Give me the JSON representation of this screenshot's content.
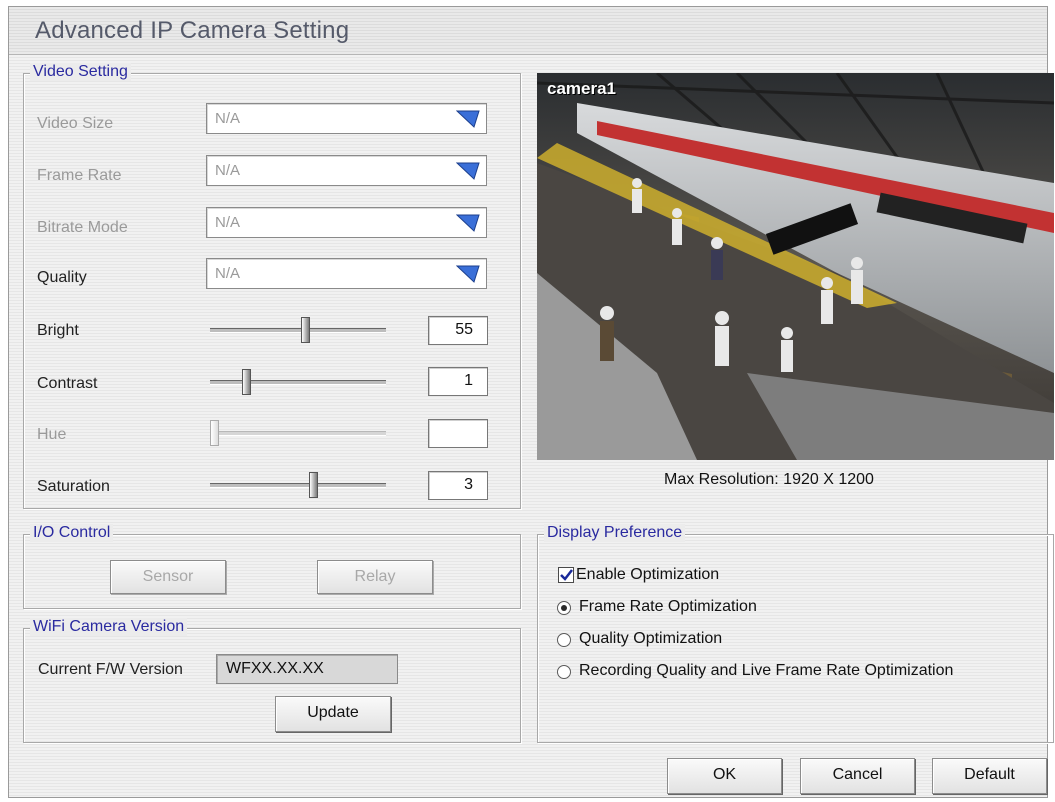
{
  "window": {
    "title": "Advanced IP Camera Setting"
  },
  "video_setting": {
    "legend": "Video Setting",
    "video_size": {
      "label": "Video Size",
      "value": "N/A"
    },
    "frame_rate": {
      "label": "Frame Rate",
      "value": "N/A"
    },
    "bitrate_mode": {
      "label": "Bitrate Mode",
      "value": "N/A"
    },
    "quality": {
      "label": "Quality",
      "value": "N/A"
    },
    "bright": {
      "label": "Bright",
      "value": "55"
    },
    "contrast": {
      "label": "Contrast",
      "value": "1"
    },
    "hue": {
      "label": "Hue",
      "value": ""
    },
    "saturation": {
      "label": "Saturation",
      "value": "3"
    }
  },
  "preview": {
    "camera_name": "camera1",
    "max_resolution": "Max Resolution: 1920 X 1200"
  },
  "io_control": {
    "legend": "I/O Control",
    "sensor_label": "Sensor",
    "relay_label": "Relay"
  },
  "wifi_version": {
    "legend": "WiFi Camera Version",
    "fw_label": "Current F/W Version",
    "fw_value": "WFXX.XX.XX",
    "update_label": "Update"
  },
  "display_preference": {
    "legend": "Display Preference",
    "enable_optimization": {
      "label": "Enable Optimization",
      "checked": true
    },
    "options": [
      {
        "label": "Frame Rate Optimization",
        "selected": true
      },
      {
        "label": "Quality Optimization",
        "selected": false
      },
      {
        "label": "Recording Quality and Live Frame Rate Optimization",
        "selected": false
      }
    ]
  },
  "footer": {
    "ok_label": "OK",
    "cancel_label": "Cancel",
    "default_label": "Default"
  },
  "colors": {
    "legend_text": "#2a2aa0",
    "combo_arrow": "#3a6fd8",
    "check_mark": "#1a2a9a"
  }
}
